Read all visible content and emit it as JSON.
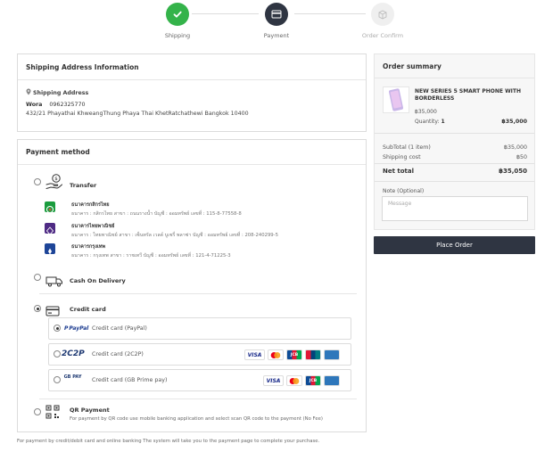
{
  "stepper": {
    "steps": [
      {
        "label": "Shipping",
        "state": "done"
      },
      {
        "label": "Payment",
        "state": "active"
      },
      {
        "label": "Order Confirm",
        "state": "pending"
      }
    ]
  },
  "shipping": {
    "title": "Shipping Address Information",
    "label": "Shipping Address",
    "name": "Wora",
    "phone": "0962325770",
    "address": "432/21 Phayathai KhweangThung Phaya Thai KhetRatchathewi Bangkok 10400"
  },
  "payment": {
    "title": "Payment method",
    "transfer": {
      "label": "Transfer",
      "banks": [
        {
          "name": "ธนาคารกสิกรไทย",
          "detail": "ธนาคาร : กสิกรไทย สาขา : ถนนรางน้ำ บัญชี : ออมทรัพย์ เลขที่ : 115-8-77558-8",
          "color": "#1a9c3e"
        },
        {
          "name": "ธนาคารไทยพาณิชย์",
          "detail": "ธนาคาร : ไทยพาณิชย์ สาขา : เซ็นทรัล เวลด์ บูเซรี่ พลาซ่า บัญชี : ออมทรัพย์ เลขที่ : 208-240299-5",
          "color": "#4e2a84"
        },
        {
          "name": "ธนาคารกรุงเทพ",
          "detail": "ธนาคาร : กรุงเทพ สาขา : ราชเทวี บัญชี : ออมทรัพย์ เลขที่ : 121-4-71225-3",
          "color": "#1e4598"
        }
      ]
    },
    "cod": {
      "label": "Cash On Delivery"
    },
    "credit": {
      "label": "Credit card",
      "options": [
        {
          "brand": "PayPal",
          "name": "Credit card (PayPal)",
          "selected": true
        },
        {
          "brand": "2C2P",
          "name": "Credit card (2C2P)",
          "selected": false
        },
        {
          "brand": "GB PAY",
          "name": "Credit card (GB Prime pay)",
          "selected": false
        }
      ],
      "card_visa": "VISA",
      "card_jcb": "JCB"
    },
    "qr": {
      "label": "QR Payment",
      "desc": "For payment by QR code use mobile banking application and select scan QR code to the payment (No Fee)"
    }
  },
  "footer_note": "For payment by credit/debit card and online banking The system will take you to the payment page to complete your purchase.",
  "summary": {
    "title": "Order summary",
    "product": {
      "name": "NEW SERIES 5 SMART PHONE WITH BORDERLESS",
      "price": "฿35,000",
      "qty_label": "Quantity:",
      "qty": "1",
      "total": "฿35,000"
    },
    "subtotal_label": "SubTotal (1 item)",
    "subtotal": "฿35,000",
    "shipping_label": "Shipping cost",
    "shipping": "฿50",
    "net_label": "Net total",
    "net": "฿35,050",
    "note_label": "Note (Optional)",
    "note_placeholder": "Message"
  },
  "place_order_label": "Place Order",
  "colors": {
    "accent": "#2f3542",
    "done": "#34b34a"
  }
}
